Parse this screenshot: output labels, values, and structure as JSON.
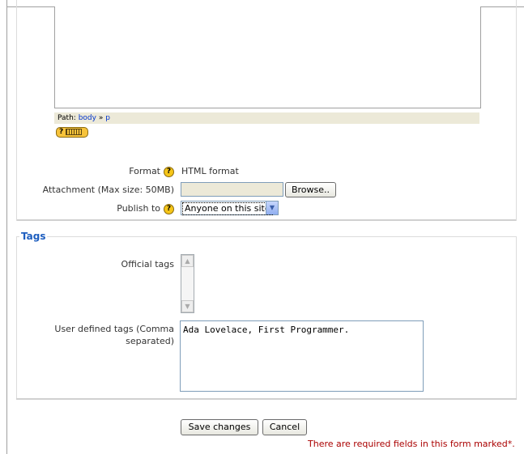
{
  "editor": {
    "path_label": "Path:",
    "path_body": "body",
    "path_sep": "»",
    "path_p": "p",
    "help_glyph": "?"
  },
  "form": {
    "format_label": "Format",
    "format_value": "HTML format",
    "attachment_label": "Attachment (Max size: 50MB)",
    "attachment_value": "",
    "browse_label": "Browse..",
    "publish_label": "Publish to",
    "publish_value": "Anyone on this site",
    "help_glyph": "?"
  },
  "tags": {
    "legend": "Tags",
    "official_label": "Official tags",
    "user_label_line1": "User defined tags (Comma",
    "user_label_line2": "separated)",
    "user_value": "Ada Lovelace, First Programmer."
  },
  "actions": {
    "save_label": "Save changes",
    "cancel_label": "Cancel",
    "required_note": "There are required fields in this form marked*."
  },
  "icons": {
    "help": "help-icon",
    "dropdown": "chevron-down-icon",
    "scroll_up": "scroll-up-icon",
    "scroll_down": "scroll-down-icon"
  },
  "colors": {
    "legend": "#1e5ebf",
    "required": "#aa0000",
    "link": "#0033cc",
    "help_badge": "#f5c518"
  }
}
